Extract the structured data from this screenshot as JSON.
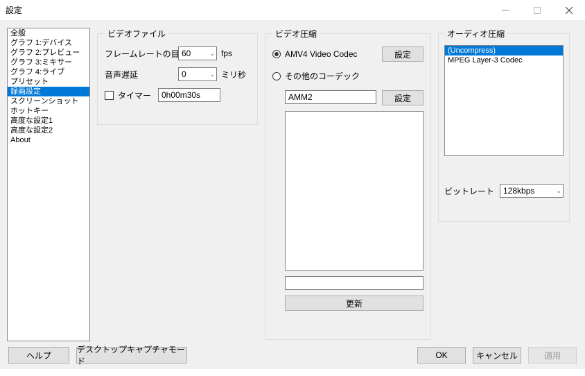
{
  "window": {
    "title": "設定"
  },
  "sidebar": {
    "items": [
      "全般",
      "グラフ 1:デバイス",
      "グラフ 2:プレビュー",
      "グラフ 3:ミキサー",
      "グラフ 4:ライブ",
      "プリセット",
      "録画設定",
      "スクリーンショット",
      "ホットキー",
      "高度な設定1",
      "高度な設定2",
      "About"
    ],
    "selected_index": 6
  },
  "video_file": {
    "legend": "ビデオファイル",
    "framerate_label": "フレームレートの目安",
    "framerate_value": "60",
    "framerate_unit": "fps",
    "audio_delay_label": "音声遅延",
    "audio_delay_value": "0",
    "audio_delay_unit": "ミリ秒",
    "timer_label": "タイマー",
    "timer_value": "0h00m30s"
  },
  "video_comp": {
    "legend": "ビデオ圧縮",
    "option1_label": "AMV4 Video Codec",
    "option1_selected": true,
    "settings_button": "設定",
    "option2_label": "その他のコーデック",
    "option2_selected": false,
    "codec_value": "AMM2",
    "settings_button2": "設定",
    "update_button": "更新"
  },
  "audio_comp": {
    "legend": "オーディオ圧縮",
    "items": [
      "(Uncompress)",
      "MPEG Layer-3 Codec"
    ],
    "selected_index": 0,
    "bitrate_label": "ビットレート",
    "bitrate_value": "128kbps"
  },
  "footer": {
    "help": "ヘルプ",
    "desktop_capture": "デスクトップキャプチャモード",
    "ok": "OK",
    "cancel": "キャンセル",
    "apply": "適用"
  }
}
